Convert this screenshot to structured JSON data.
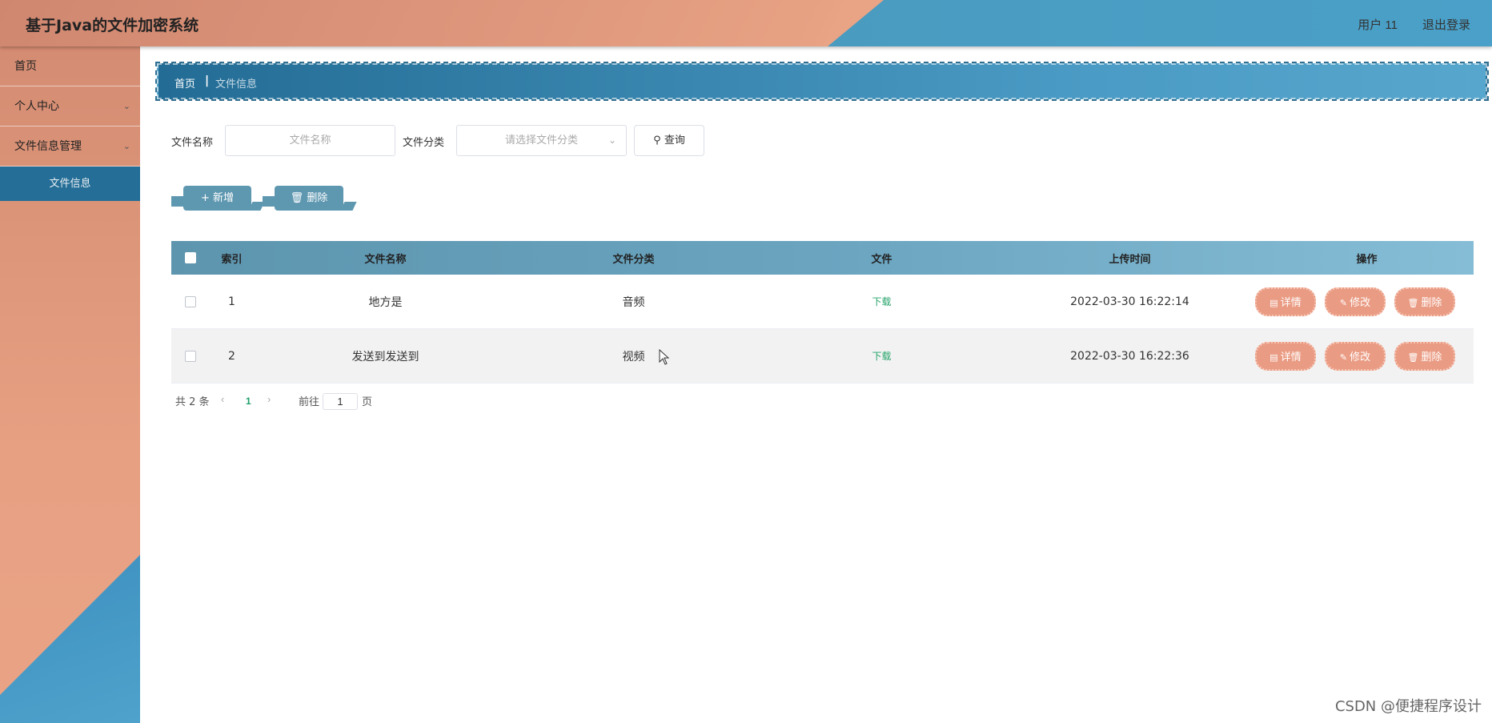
{
  "header": {
    "title": "基于Java的文件加密系统",
    "user": "用户 11",
    "logout": "退出登录"
  },
  "sidebar": {
    "items": [
      {
        "label": "首页"
      },
      {
        "label": "个人中心"
      },
      {
        "label": "文件信息管理"
      }
    ],
    "sub_item": "文件信息"
  },
  "breadcrumb": {
    "home": "首页",
    "separator": "|",
    "current": "文件信息"
  },
  "search": {
    "name_label": "文件名称",
    "name_placeholder": "文件名称",
    "category_label": "文件分类",
    "category_placeholder": "请选择文件分类",
    "query_button": "查询"
  },
  "actions": {
    "add": "新增",
    "delete": "删除"
  },
  "table": {
    "columns": [
      "索引",
      "文件名称",
      "文件分类",
      "文件",
      "上传时间",
      "操作"
    ],
    "rows": [
      {
        "index": "1",
        "name": "地方是",
        "category": "音频",
        "file": "下载",
        "time": "2022-03-30 16:22:14"
      },
      {
        "index": "2",
        "name": "发送到发送到",
        "category": "视频",
        "file": "下载",
        "time": "2022-03-30 16:22:36"
      }
    ],
    "row_actions": {
      "detail": "详情",
      "edit": "修改",
      "delete": "删除"
    }
  },
  "pagination": {
    "total": "共 2 条",
    "current": "1",
    "goto_label": "前往",
    "goto_value": "1",
    "page_suffix": "页"
  },
  "watermark": "CSDN @便捷程序设计",
  "colors": {
    "accent_orange": "#ea9b83",
    "accent_blue": "#246e97",
    "download_green": "#26a46b"
  }
}
